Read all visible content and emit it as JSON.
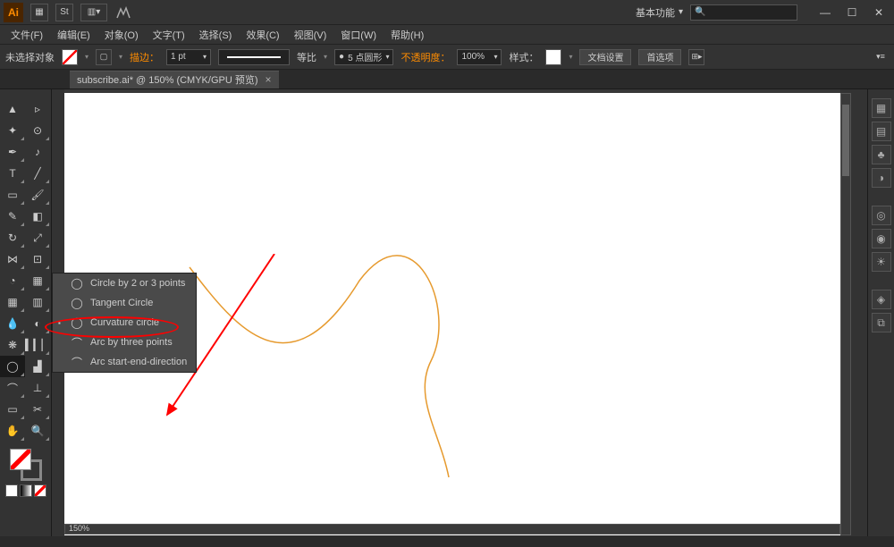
{
  "app": {
    "logo": "Ai"
  },
  "workspace": {
    "label": "基本功能"
  },
  "menubar": {
    "file": "文件(F)",
    "edit": "编辑(E)",
    "object": "对象(O)",
    "type": "文字(T)",
    "select": "选择(S)",
    "effect": "效果(C)",
    "view": "视图(V)",
    "window": "窗口(W)",
    "help": "帮助(H)"
  },
  "control": {
    "selection": "未选择对象",
    "stroke_label": "描边：",
    "stroke_weight": "1 pt",
    "brush_label": "等比",
    "profile": "5 点圆形",
    "opacity_label": "不透明度：",
    "opacity": "100%",
    "style_label": "样式：",
    "doc_setup": "文档设置",
    "preferences": "首选项"
  },
  "tab": {
    "title": "subscribe.ai* @ 150% (CMYK/GPU 预览)"
  },
  "flyout": {
    "items": [
      {
        "icon": "◯",
        "label": "Circle by 2 or 3 points"
      },
      {
        "icon": "◯",
        "label": "Tangent Circle"
      },
      {
        "icon": "◯",
        "label": "Curvature circle"
      },
      {
        "icon": "⌒",
        "label": "Arc by three points"
      },
      {
        "icon": "⌒",
        "label": "Arc start-end-direction"
      }
    ]
  },
  "zoom": "150%"
}
